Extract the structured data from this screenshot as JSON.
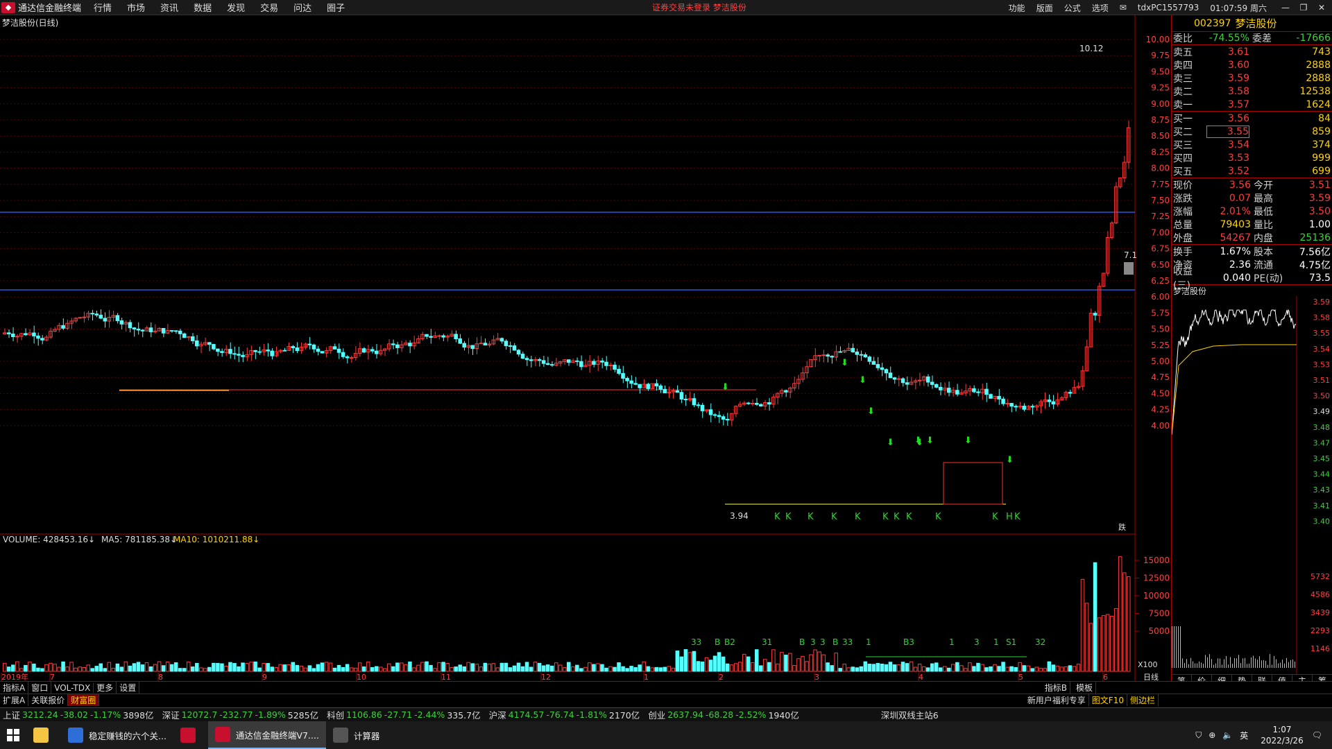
{
  "app": {
    "title": "通达信金融终端",
    "menu": [
      "行情",
      "市场",
      "资讯",
      "数据",
      "发现",
      "交易",
      "问达",
      "圈子"
    ],
    "center_msg": "证券交易未登录  梦洁股份",
    "right_menu": [
      "功能",
      "版面",
      "公式",
      "选项"
    ],
    "account": "tdxPC1557793",
    "time": "01:07:59 周六"
  },
  "chart": {
    "title": "梦洁股份(日线)",
    "high_label": "10.12",
    "low_label": "3.94",
    "mark_label": "7.1",
    "price_axis": [
      "10.00",
      "9.75",
      "9.50",
      "9.25",
      "9.00",
      "8.75",
      "8.50",
      "8.25",
      "8.00",
      "7.75",
      "7.50",
      "7.25",
      "7.00",
      "6.75",
      "6.50",
      "6.25",
      "6.00",
      "5.75",
      "5.50",
      "5.25",
      "5.00",
      "4.75",
      "4.50",
      "4.25",
      "4.00"
    ],
    "month_labels": [
      "2019年",
      "7",
      "8",
      "9",
      "10",
      "11",
      "12",
      "1",
      "2",
      "3",
      "4",
      "5",
      "6"
    ],
    "volume_title": "VOLUME: 428453.16↓",
    "ma5": "MA5: 781185.38↓",
    "ma10": "MA10: 1010211.88↓",
    "volume_axis": [
      "15000",
      "12500",
      "10000",
      "7500",
      "5000"
    ],
    "volume_unit": "X100",
    "period": "日线",
    "corner_label": "跌",
    "signals_bottom": [
      "33",
      "B",
      "B2",
      "31",
      "B",
      "3",
      "3",
      "B",
      "33",
      "1",
      "B3",
      "1",
      "3",
      "1",
      "S1",
      "32"
    ],
    "signal_K_row": [
      "K",
      "K",
      "K",
      "K",
      "K",
      "K",
      "K",
      "K",
      "K",
      "K",
      "K",
      "H"
    ]
  },
  "quote": {
    "code": "002397",
    "name": "梦洁股份",
    "wb_label": "委比",
    "wb_value": "-74.55%",
    "wc_label": "委差",
    "wc_value": "-17666",
    "asks": [
      {
        "label": "卖五",
        "price": "3.61",
        "vol": "743"
      },
      {
        "label": "卖四",
        "price": "3.60",
        "vol": "2888"
      },
      {
        "label": "卖三",
        "price": "3.59",
        "vol": "2888"
      },
      {
        "label": "卖二",
        "price": "3.58",
        "vol": "12538"
      },
      {
        "label": "卖一",
        "price": "3.57",
        "vol": "1624"
      }
    ],
    "bids": [
      {
        "label": "买一",
        "price": "3.56",
        "vol": "84"
      },
      {
        "label": "买二",
        "price": "3.55",
        "vol": "859"
      },
      {
        "label": "买三",
        "price": "3.54",
        "vol": "374"
      },
      {
        "label": "买四",
        "price": "3.53",
        "vol": "999"
      },
      {
        "label": "买五",
        "price": "3.52",
        "vol": "699"
      }
    ],
    "stats": [
      {
        "l1": "现价",
        "v1": "3.56",
        "l2": "今开",
        "v2": "3.51"
      },
      {
        "l1": "涨跌",
        "v1": "0.07",
        "l2": "最高",
        "v2": "3.59"
      },
      {
        "l1": "涨幅",
        "v1": "2.01%",
        "l2": "最低",
        "v2": "3.50"
      },
      {
        "l1": "总量",
        "v1": "79403",
        "l2": "量比",
        "v2": "1.00"
      },
      {
        "l1": "外盘",
        "v1": "54267",
        "l2": "内盘",
        "v2": "25136"
      }
    ],
    "stats2": [
      {
        "l1": "换手",
        "v1": "1.67%",
        "l2": "股本",
        "v2": "7.56亿"
      },
      {
        "l1": "净资",
        "v1": "2.36",
        "l2": "流通",
        "v2": "4.75亿"
      },
      {
        "l1": "收益(三)",
        "v1": "0.040",
        "l2": "PE(动)",
        "v2": "73.5"
      }
    ],
    "mini_title": "梦洁股份",
    "mini_axis": [
      "3.59",
      "3.58",
      "3.55",
      "3.54",
      "3.53",
      "3.51",
      "3.50",
      "3.49",
      "3.48",
      "3.47",
      "3.45",
      "3.44",
      "3.43",
      "3.41",
      "3.40"
    ],
    "mini_vol_axis": [
      "5732",
      "4586",
      "3439",
      "2293",
      "1146"
    ],
    "bottom_tabs": [
      "笔",
      "价",
      "细",
      "势",
      "联",
      "值",
      "主",
      "筹"
    ]
  },
  "tabs1": [
    "指标A",
    "窗口",
    "VOL-TDX",
    "更多",
    "设置"
  ],
  "tabs1_right": [
    "指标B",
    "模板"
  ],
  "tabs2": [
    "扩展A",
    "关联报价",
    "财富圈"
  ],
  "tabs2_right": [
    "新用户福利专享",
    "图文F10",
    "侧边栏"
  ],
  "indices": [
    {
      "name": "上证",
      "val": "3212.24",
      "chg": "-38.02",
      "pct": "-1.17%",
      "amt": "3898亿"
    },
    {
      "name": "深证",
      "val": "12072.7",
      "chg": "-232.77",
      "pct": "-1.89%",
      "amt": "5285亿"
    },
    {
      "name": "科创",
      "val": "1106.86",
      "chg": "-27.71",
      "pct": "-2.44%",
      "amt": "335.7亿"
    },
    {
      "name": "沪深",
      "val": "4174.57",
      "chg": "-76.74",
      "pct": "-1.81%",
      "amt": "2170亿"
    },
    {
      "name": "创业",
      "val": "2637.94",
      "chg": "-68.28",
      "pct": "-2.52%",
      "amt": "1940亿"
    }
  ],
  "server": "深圳双线主站6",
  "taskbar": {
    "items": [
      "稳定赚钱的六个关...",
      "通达信金融终端V7....",
      "计算器"
    ],
    "ime": "英",
    "time": "1:07",
    "date": "2022/3/26"
  },
  "colors": {
    "up": "#ff3c3c",
    "down": "#54ffff",
    "accent": "#ffd400",
    "signal": "#22dd22"
  }
}
